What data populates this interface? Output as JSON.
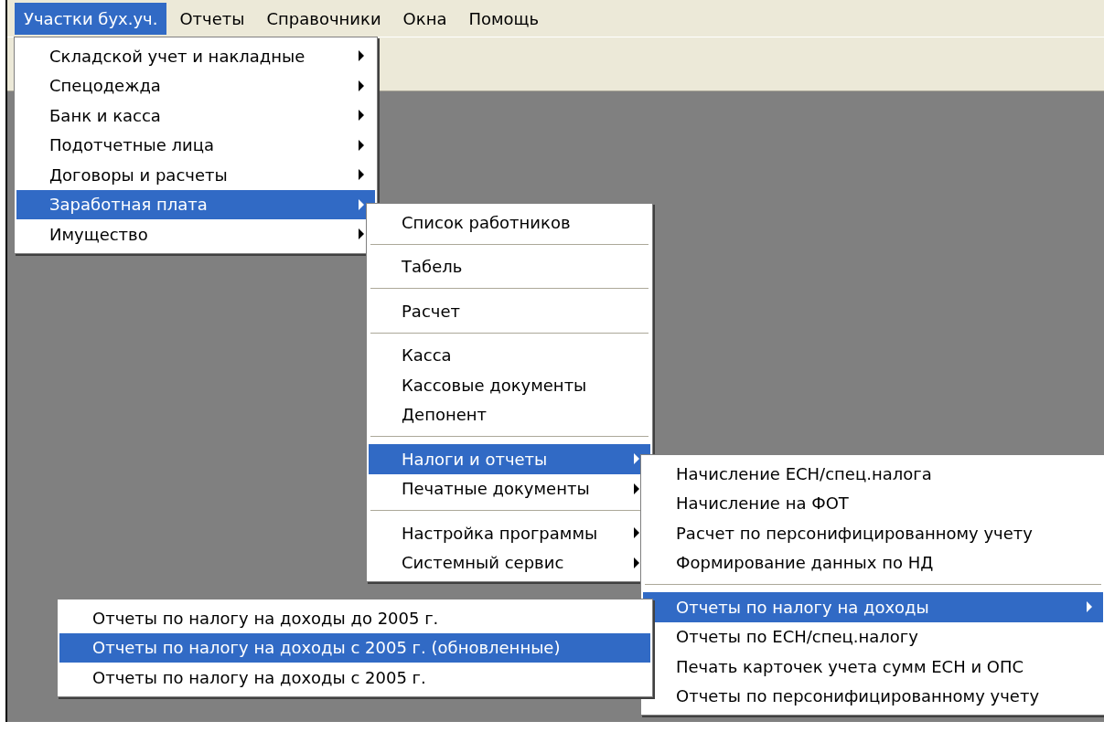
{
  "menubar": [
    {
      "label": "Участки бух.уч.",
      "selected": true
    },
    {
      "label": "Отчеты",
      "selected": false
    },
    {
      "label": "Справочники",
      "selected": false
    },
    {
      "label": "Окна",
      "selected": false
    },
    {
      "label": "Помощь",
      "selected": false
    }
  ],
  "menus": [
    {
      "items": [
        {
          "kind": "item",
          "label": "Складской  учет и накладные",
          "selected": false,
          "submenu": true
        },
        {
          "kind": "item",
          "label": "Спецодежда",
          "selected": false,
          "submenu": true
        },
        {
          "kind": "item",
          "label": "Банк и касса",
          "selected": false,
          "submenu": true
        },
        {
          "kind": "item",
          "label": "Подотчетные лица",
          "selected": false,
          "submenu": true
        },
        {
          "kind": "item",
          "label": "Договоры и расчеты",
          "selected": false,
          "submenu": true
        },
        {
          "kind": "item",
          "label": "Заработная плата",
          "selected": true,
          "submenu": true
        },
        {
          "kind": "item",
          "label": "Имущество",
          "selected": false,
          "submenu": true
        }
      ]
    },
    {
      "items": [
        {
          "kind": "item",
          "label": "Список работников",
          "selected": false,
          "submenu": false
        },
        {
          "kind": "separator"
        },
        {
          "kind": "item",
          "label": "Табель",
          "selected": false,
          "submenu": false
        },
        {
          "kind": "separator"
        },
        {
          "kind": "item",
          "label": "Расчет",
          "selected": false,
          "submenu": false
        },
        {
          "kind": "separator"
        },
        {
          "kind": "item",
          "label": "Касса",
          "selected": false,
          "submenu": false
        },
        {
          "kind": "item",
          "label": "Кассовые документы",
          "selected": false,
          "submenu": false
        },
        {
          "kind": "item",
          "label": "Депонент",
          "selected": false,
          "submenu": false
        },
        {
          "kind": "separator"
        },
        {
          "kind": "item",
          "label": "Налоги и отчеты",
          "selected": true,
          "submenu": true
        },
        {
          "kind": "item",
          "label": "Печатные документы",
          "selected": false,
          "submenu": true
        },
        {
          "kind": "separator"
        },
        {
          "kind": "item",
          "label": "Настройка программы",
          "selected": false,
          "submenu": true
        },
        {
          "kind": "item",
          "label": "Системный сервис",
          "selected": false,
          "submenu": true
        }
      ]
    },
    {
      "items": [
        {
          "kind": "item",
          "label": "Начисление ЕСН/спец.налога",
          "selected": false,
          "submenu": false
        },
        {
          "kind": "item",
          "label": "Начисление на ФОТ",
          "selected": false,
          "submenu": false
        },
        {
          "kind": "item",
          "label": "Расчет по персонифицированному учету",
          "selected": false,
          "submenu": false
        },
        {
          "kind": "item",
          "label": "Формирование данных по НД",
          "selected": false,
          "submenu": false
        },
        {
          "kind": "separator"
        },
        {
          "kind": "item",
          "label": "Отчеты по налогу на доходы",
          "selected": true,
          "submenu": true
        },
        {
          "kind": "item",
          "label": "Отчеты по ЕСН/спец.налогу",
          "selected": false,
          "submenu": false
        },
        {
          "kind": "item",
          "label": "Печать карточек учета сумм ЕСН и ОПС",
          "selected": false,
          "submenu": false
        },
        {
          "kind": "item",
          "label": "Отчеты по персонифицированному учету",
          "selected": false,
          "submenu": false
        }
      ]
    },
    {
      "items": [
        {
          "kind": "item",
          "label": "Отчеты по налогу на доходы до 2005 г.",
          "selected": false,
          "submenu": false
        },
        {
          "kind": "item",
          "label": "Отчеты по налогу на доходы с 2005 г. (обновленные)",
          "selected": true,
          "submenu": false
        },
        {
          "kind": "item",
          "label": "Отчеты по налогу на доходы с 2005 г.",
          "selected": false,
          "submenu": false
        }
      ]
    }
  ]
}
